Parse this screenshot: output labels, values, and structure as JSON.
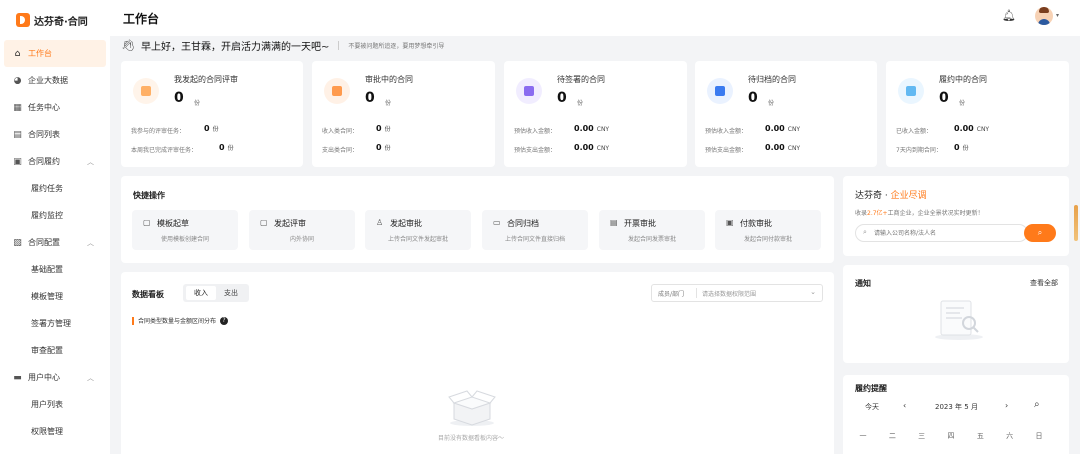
{
  "brand": {
    "name": "达芬奇·合同"
  },
  "header": {
    "title": "工作台"
  },
  "greeting": {
    "text": "早上好，王甘霖，开启活力满满的一天吧~",
    "hint": "不要被问题所追逐，要用梦想牵引导"
  },
  "sidebar": {
    "items": [
      {
        "label": "工作台"
      },
      {
        "label": "企业大数据"
      },
      {
        "label": "任务中心"
      },
      {
        "label": "合同列表"
      },
      {
        "label": "合同履约"
      },
      {
        "label": "履约任务"
      },
      {
        "label": "履约监控"
      },
      {
        "label": "合同配置"
      },
      {
        "label": "基础配置"
      },
      {
        "label": "模板管理"
      },
      {
        "label": "签署方管理"
      },
      {
        "label": "审查配置"
      },
      {
        "label": "用户中心"
      },
      {
        "label": "用户列表"
      },
      {
        "label": "权限管理"
      }
    ]
  },
  "stats": [
    {
      "title": "我发起的合同评审",
      "value": "0",
      "unit": "份",
      "color": "#ffb066",
      "bg": "#fff4ea",
      "rows": [
        {
          "label": "我参与的评审任务：",
          "value": "0",
          "unit": "份"
        },
        {
          "label": "本周我已完成评审任务：",
          "value": "0",
          "unit": "份"
        }
      ]
    },
    {
      "title": "审批中的合同",
      "value": "0",
      "unit": "份",
      "color": "#ff9a4d",
      "bg": "#fff1e6",
      "rows": [
        {
          "label": "收入类合同：",
          "value": "0",
          "unit": "份"
        },
        {
          "label": "支出类合同：",
          "value": "0",
          "unit": "份"
        }
      ]
    },
    {
      "title": "待签署的合同",
      "value": "0",
      "unit": "份",
      "color": "#8a6cf0",
      "bg": "#f1edff",
      "rows": [
        {
          "label": "预估收入金额：",
          "value": "0.00",
          "unit": "CNY"
        },
        {
          "label": "预估支出金额：",
          "value": "0.00",
          "unit": "CNY"
        }
      ]
    },
    {
      "title": "待归档的合同",
      "value": "0",
      "unit": "份",
      "color": "#3a7bf0",
      "bg": "#eaf2ff",
      "rows": [
        {
          "label": "预估收入金额：",
          "value": "0.00",
          "unit": "CNY"
        },
        {
          "label": "预估支出金额：",
          "value": "0.00",
          "unit": "CNY"
        }
      ]
    },
    {
      "title": "履约中的合同",
      "value": "0",
      "unit": "份",
      "color": "#62b9f2",
      "bg": "#eaf6ff",
      "rows": [
        {
          "label": "已收入金额：",
          "value": "0.00",
          "unit": "CNY"
        },
        {
          "label": "7天内到期合同：",
          "value": "0",
          "unit": "份"
        }
      ]
    }
  ],
  "quick_actions": {
    "title": "快捷操作",
    "items": [
      {
        "label": "模板起草",
        "sub": "使用模板创建合同",
        "icon": "template-icon"
      },
      {
        "label": "发起评审",
        "sub": "内外协同",
        "icon": "review-icon"
      },
      {
        "label": "发起审批",
        "sub": "上传合同文件发起审批",
        "icon": "approval-icon"
      },
      {
        "label": "合同归档",
        "sub": "上传合同文件直接归档",
        "icon": "archive-icon"
      },
      {
        "label": "开票审批",
        "sub": "发起合同发票审批",
        "icon": "invoice-icon"
      },
      {
        "label": "付款审批",
        "sub": "发起合同付款审批",
        "icon": "payment-icon"
      }
    ]
  },
  "enterprise": {
    "title_prefix": "达芬奇 · ",
    "title_highlight": "企业尽调",
    "sub_prefix": "收录",
    "sub_highlight": "2.7亿+",
    "sub_suffix": "工商企业，企业全景状况实时更新！",
    "placeholder": "请输入公司名称/法人名"
  },
  "dashboard": {
    "title": "数据看板",
    "tabs": [
      "收入",
      "支出"
    ],
    "filter_label": "成员/部门",
    "filter_placeholder": "请选择数据权限范围",
    "subtitle": "合同类型数量与金额区间分布",
    "empty_text": "目前没有数据看板内容～"
  },
  "notice": {
    "title": "通知",
    "more": "查看全部"
  },
  "reminder": {
    "title": "履约提醒",
    "today": "今天",
    "month": "2023 年 5 月",
    "weekdays": [
      "一",
      "二",
      "三",
      "四",
      "五",
      "六",
      "日"
    ]
  }
}
